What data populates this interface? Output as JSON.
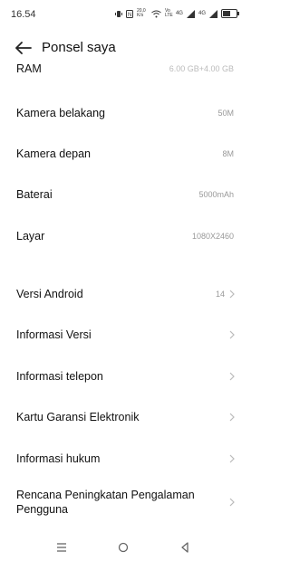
{
  "status": {
    "time": "16.54",
    "icons": [
      "vibrate",
      "nfc",
      "speed",
      "wifi",
      "volte",
      "4g-signal",
      "4g-signal-2",
      "battery"
    ],
    "speed_text": "20,0 K/s",
    "volte_text": "Vo LTE",
    "net_text": "4G",
    "net_text_2": "4G"
  },
  "header": {
    "title": "Ponsel saya"
  },
  "rows": [
    {
      "label": "RAM",
      "value": "6.00 GB+4.00 GB"
    },
    {
      "label": "Kamera belakang",
      "value": "50M"
    },
    {
      "label": "Kamera depan",
      "value": "8M"
    },
    {
      "label": "Baterai",
      "value": "5000mAh"
    },
    {
      "label": "Layar",
      "value": "1080X2460"
    },
    {
      "label": "Versi Android",
      "value": "14"
    },
    {
      "label": "Informasi Versi",
      "value": ""
    },
    {
      "label": "Informasi telepon",
      "value": ""
    },
    {
      "label": "Kartu Garansi Elektronik",
      "value": ""
    },
    {
      "label": "Informasi hukum",
      "value": ""
    },
    {
      "label": "Rencana Peningkatan Pengalaman Pengguna",
      "value": ""
    }
  ],
  "nav": {
    "buttons": [
      "menu-icon",
      "home-icon",
      "back-icon"
    ]
  }
}
